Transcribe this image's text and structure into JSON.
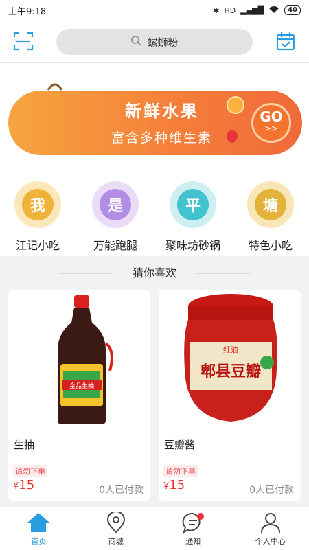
{
  "status": {
    "time": "上午9:18",
    "network": "HD",
    "battery": "40"
  },
  "header": {
    "search_text": "螺蛳粉",
    "scan_icon": "scan-icon",
    "calendar_icon": "calendar-icon"
  },
  "banner": {
    "line1": "新鲜水果",
    "line2": "富含多种维生素",
    "go_text": "GO",
    "go_arrow": ">>"
  },
  "categories": [
    {
      "char": "我",
      "label": "江记小吃",
      "color": "#f0b33a"
    },
    {
      "char": "是",
      "label": "万能跑腿",
      "color": "#b38ee6"
    },
    {
      "char": "平",
      "label": "聚味坊砂锅",
      "color": "#43c2cf"
    },
    {
      "char": "塘",
      "label": "特色小吃",
      "color": "#e2b23a"
    }
  ],
  "section_title": "猜你喜欢",
  "products": [
    {
      "name": "生抽",
      "tag": "请勿下单",
      "currency": "¥",
      "price": "15",
      "sold": "0人已付款",
      "label_text": "金品生抽"
    },
    {
      "name": "豆瓣酱",
      "tag": "请勿下单",
      "currency": "¥",
      "price": "15",
      "sold": "0人已付款",
      "label_text": "郫县豆瓣",
      "label_top": "红油"
    }
  ],
  "tabs": [
    {
      "label": "首页",
      "icon": "home-icon",
      "active": true
    },
    {
      "label": "商城",
      "icon": "map-pin-icon"
    },
    {
      "label": "通知",
      "icon": "chat-icon",
      "badge": true
    },
    {
      "label": "个人中心",
      "icon": "person-icon"
    }
  ],
  "colors": {
    "accent": "#2a9de0",
    "price": "#e5322d",
    "banner": "#f5803a"
  }
}
